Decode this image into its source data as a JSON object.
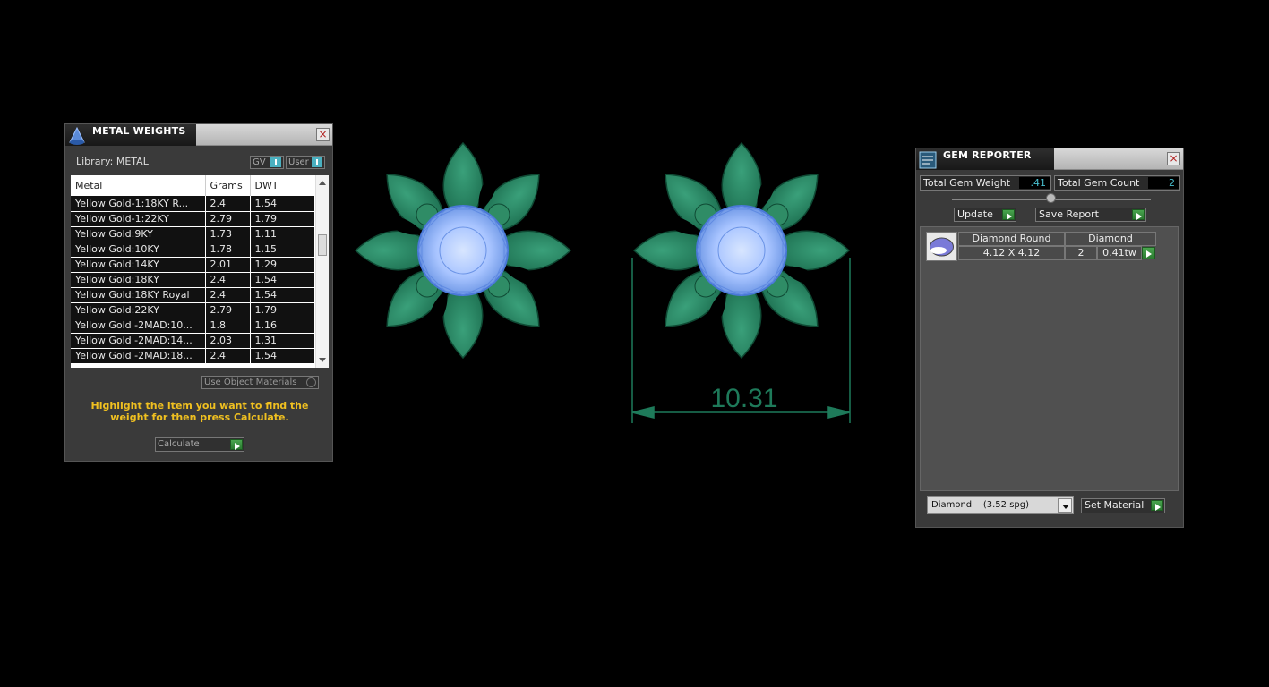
{
  "metal_weights": {
    "title": "METAL WEIGHTS",
    "library_label": "Library: METAL",
    "toggle_gv": "GV",
    "toggle_user": "User",
    "columns": [
      "Metal",
      "Grams",
      "DWT"
    ],
    "rows": [
      [
        "Yellow Gold-1:18KY R...",
        "2.4",
        "1.54"
      ],
      [
        "Yellow Gold-1:22KY",
        "2.79",
        "1.79"
      ],
      [
        "Yellow Gold:9KY",
        "1.73",
        "1.11"
      ],
      [
        "Yellow Gold:10KY",
        "1.78",
        "1.15"
      ],
      [
        "Yellow Gold:14KY",
        "2.01",
        "1.29"
      ],
      [
        "Yellow Gold:18KY",
        "2.4",
        "1.54"
      ],
      [
        "Yellow Gold:18KY Royal",
        "2.4",
        "1.54"
      ],
      [
        "Yellow Gold:22KY",
        "2.79",
        "1.79"
      ],
      [
        "Yellow Gold -2MAD:10...",
        "1.8",
        "1.16"
      ],
      [
        "Yellow Gold -2MAD:14...",
        "2.03",
        "1.31"
      ],
      [
        "Yellow Gold -2MAD:18...",
        "2.4",
        "1.54"
      ]
    ],
    "use_object_materials": "Use Object Materials",
    "hint": "Highlight the item you want to find the weight for then press Calculate.",
    "calculate_label": "Calculate"
  },
  "viewport": {
    "dimension_value": "10.31",
    "colors": {
      "metal": "#1e7a5a",
      "gem": "#8ab0f0"
    }
  },
  "gem_reporter": {
    "title": "GEM REPORTER",
    "total_gem_weight_label": "Total Gem Weight",
    "total_gem_weight_value": ".41",
    "total_gem_count_label": "Total Gem Count",
    "total_gem_count_value": "2",
    "update_label": "Update",
    "save_report_label": "Save Report",
    "gem": {
      "shape": "Diamond Round",
      "material": "Diamond",
      "size": "4.12 X 4.12",
      "count": "2",
      "weight": "0.41tw"
    },
    "material_select": "Diamond    (3.52 spg)",
    "set_material_label": "Set Material"
  }
}
